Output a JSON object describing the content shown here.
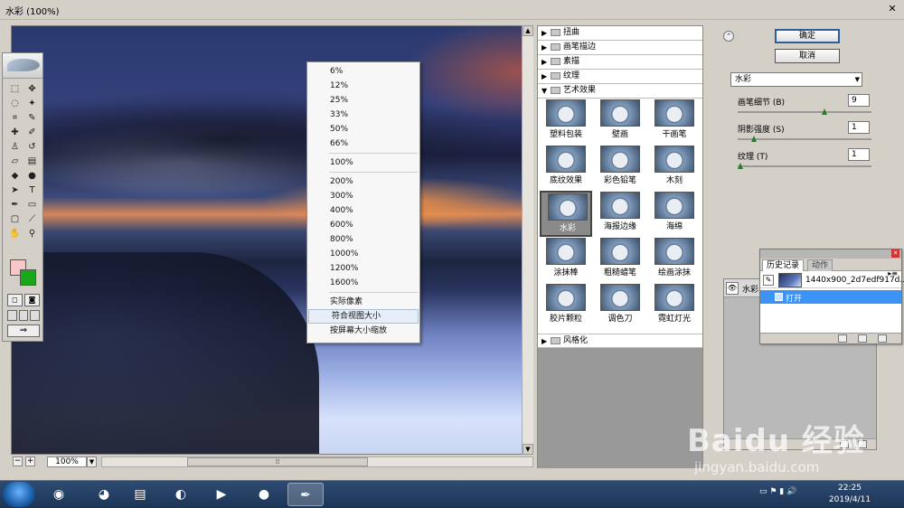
{
  "window": {
    "title": "水彩 (100%)",
    "close_glyph": "✕"
  },
  "zoom": {
    "value": "100%",
    "minus": "−",
    "plus": "+"
  },
  "context_menu": {
    "items": [
      "6%",
      "12%",
      "25%",
      "33%",
      "50%",
      "66%",
      "100%",
      "200%",
      "300%",
      "400%",
      "600%",
      "800%",
      "1000%",
      "1200%",
      "1600%",
      "实际像素",
      "符合视图大小",
      "按屏幕大小缩放"
    ],
    "highlighted": "符合视图大小"
  },
  "filter_gallery": {
    "categories_top": [
      "扭曲",
      "画笔描边",
      "素描",
      "纹理",
      "艺术效果"
    ],
    "category_bottom": "风格化",
    "filters": [
      "塑料包装",
      "壁画",
      "干画笔",
      "底纹效果",
      "彩色铅笔",
      "木刻",
      "水彩",
      "海报边缘",
      "海绵",
      "涂抹棒",
      "粗糙蜡笔",
      "绘画涂抹",
      "胶片颗粒",
      "调色刀",
      "霓虹灯光"
    ],
    "selected": "水彩"
  },
  "settings": {
    "ok_label": "确定",
    "cancel_label": "取消",
    "filter_select": "水彩",
    "params": [
      {
        "label": "画笔细节 (B)",
        "value": "9",
        "fraction": 0.64
      },
      {
        "label": "阴影强度 (S)",
        "value": "1",
        "fraction": 0.1
      },
      {
        "label": "纹理 (T)",
        "value": "1",
        "fraction": 0.0
      }
    ],
    "layer_name": "水彩"
  },
  "history": {
    "tab_history": "历史记录",
    "tab_actions": "动作",
    "snapshot_name": "1440x900_2d7edf917d...",
    "state_open": "打开"
  },
  "taskbar": {
    "time": "22:25",
    "date": "2019/4/11"
  },
  "watermark": {
    "logo": "Baidu 经验",
    "url": "jingyan.baidu.com"
  }
}
